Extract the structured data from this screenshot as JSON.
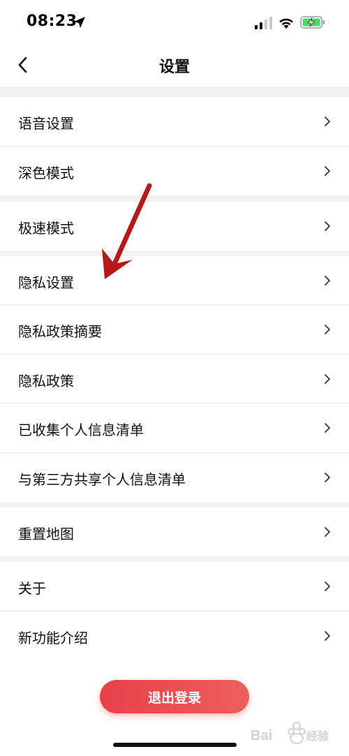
{
  "status_bar": {
    "time": "08:23",
    "icons": [
      "location-arrow-icon",
      "cellular-signal-icon",
      "wifi-icon",
      "battery-charging-icon"
    ],
    "battery_color": "#4cd964"
  },
  "nav": {
    "back_icon": "chevron-left-icon",
    "title": "设置"
  },
  "groups": [
    {
      "items": [
        {
          "label": "语音设置"
        },
        {
          "label": "深色模式"
        }
      ]
    },
    {
      "items": [
        {
          "label": "极速模式"
        }
      ]
    },
    {
      "items": [
        {
          "label": "隐私设置"
        },
        {
          "label": "隐私政策摘要"
        },
        {
          "label": "隐私政策"
        },
        {
          "label": "已收集个人信息清单"
        },
        {
          "label": "与第三方共享个人信息清单"
        }
      ]
    },
    {
      "items": [
        {
          "label": "重置地图"
        }
      ]
    },
    {
      "items": [
        {
          "label": "关于"
        },
        {
          "label": "新功能介绍"
        }
      ]
    }
  ],
  "logout": {
    "label": "退出登录",
    "color_start": "#e8414a",
    "color_end": "#ec5f5a"
  },
  "annotation": {
    "arrow_color": "#b5191a",
    "points_to": "隐私设置"
  }
}
